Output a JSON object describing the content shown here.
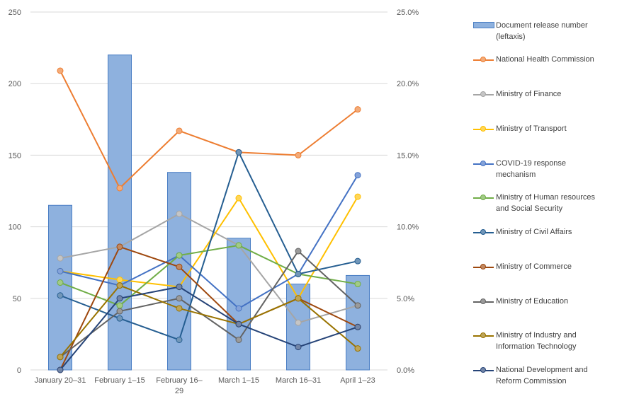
{
  "chart_data": {
    "type": "bar+line",
    "title": "",
    "categories": [
      "January 20–31",
      "February 1–15",
      "February 16–29",
      "March 1–15",
      "March 16–31",
      "April 1–23"
    ],
    "left_axis": {
      "label": "",
      "range": [
        0,
        250
      ],
      "ticks": [
        "0",
        "50",
        "100",
        "150",
        "200",
        "250"
      ]
    },
    "right_axis": {
      "label": "",
      "range": [
        0,
        25
      ],
      "ticks": [
        "0.0%",
        "5.0%",
        "10.0%",
        "15.0%",
        "20.0%",
        "25.0%"
      ]
    },
    "grid": true,
    "legend_position": "right",
    "bar_series": {
      "name": "Document release number (leftaxis)",
      "color": "#8EB1DE",
      "border": "#4A7EC4",
      "values": [
        115,
        220,
        138,
        92,
        60,
        66
      ]
    },
    "series": [
      {
        "name": "National Health Commission",
        "color": "#ED7D31",
        "values": [
          20.9,
          12.7,
          16.7,
          15.2,
          15.0,
          18.2
        ]
      },
      {
        "name": "Ministry of Finance",
        "color": "#A5A5A5",
        "values": [
          7.8,
          8.6,
          10.9,
          8.7,
          3.3,
          4.5
        ]
      },
      {
        "name": "Ministry of Transport",
        "color": "#FFC000",
        "values": [
          6.9,
          6.3,
          5.8,
          12.0,
          5.0,
          12.1
        ]
      },
      {
        "name": "COVID-19 response mechanism",
        "color": "#4472C4",
        "values": [
          6.9,
          5.9,
          8.0,
          4.3,
          6.7,
          13.6
        ]
      },
      {
        "name": "Ministry of Human resources and Social Security",
        "color": "#70AD47",
        "values": [
          6.1,
          4.5,
          8.0,
          8.7,
          6.7,
          6.0
        ]
      },
      {
        "name": "Ministry of Civil Affairs",
        "color": "#255E91",
        "values": [
          5.2,
          3.6,
          2.1,
          15.2,
          6.7,
          7.6
        ]
      },
      {
        "name": "Ministry of Commerce",
        "color": "#9E480E",
        "values": [
          0.0,
          8.6,
          7.2,
          3.2,
          5.0,
          3.0
        ]
      },
      {
        "name": "Ministry of Education",
        "color": "#636363",
        "values": [
          0.9,
          4.1,
          5.0,
          2.1,
          8.3,
          4.5
        ]
      },
      {
        "name": "Ministry of Industry and Information Technology",
        "color": "#997300",
        "values": [
          0.9,
          5.9,
          4.3,
          3.2,
          5.0,
          1.5
        ]
      },
      {
        "name": "National Development and Reform Commission",
        "color": "#264478",
        "values": [
          0.0,
          5.0,
          5.8,
          3.2,
          1.6,
          3.0
        ]
      }
    ]
  },
  "legend": {
    "items": [
      {
        "label": "Document release number (leftaxis)"
      },
      {
        "label": "National Health Commission"
      },
      {
        "label": "Ministry of Finance"
      },
      {
        "label": "Ministry of Transport"
      },
      {
        "label": "COVID-19 response mechanism"
      },
      {
        "label": "Ministry of Human resources and Social Security"
      },
      {
        "label": "Ministry of Civil Affairs"
      },
      {
        "label": "Ministry of Commerce"
      },
      {
        "label": "Ministry of Education"
      },
      {
        "label": "Ministry of Industry and Information Technology"
      },
      {
        "label": "National Development and Reform Commission"
      }
    ]
  }
}
